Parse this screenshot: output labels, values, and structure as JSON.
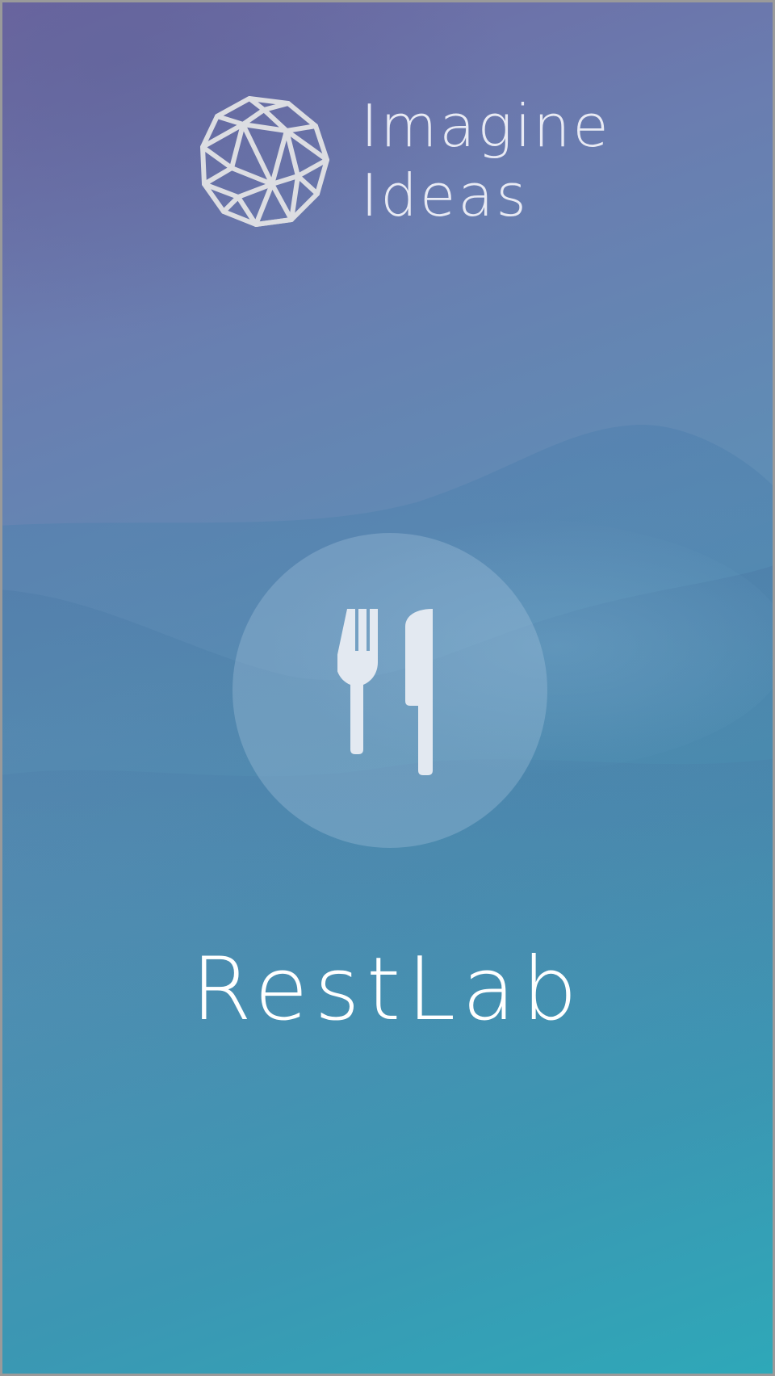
{
  "brand": {
    "line1": "Imagine",
    "line2": "Ideas",
    "logo_icon": "geodesic-sphere-icon"
  },
  "app": {
    "name": "RestLab",
    "center_icon": "fork-knife-icon"
  },
  "colors": {
    "gradient_top": "#6e66a1",
    "gradient_middle": "#5f8db5",
    "gradient_bottom": "#2ea8b8",
    "text": "#ffffff",
    "icon": "#e2e8f0"
  }
}
